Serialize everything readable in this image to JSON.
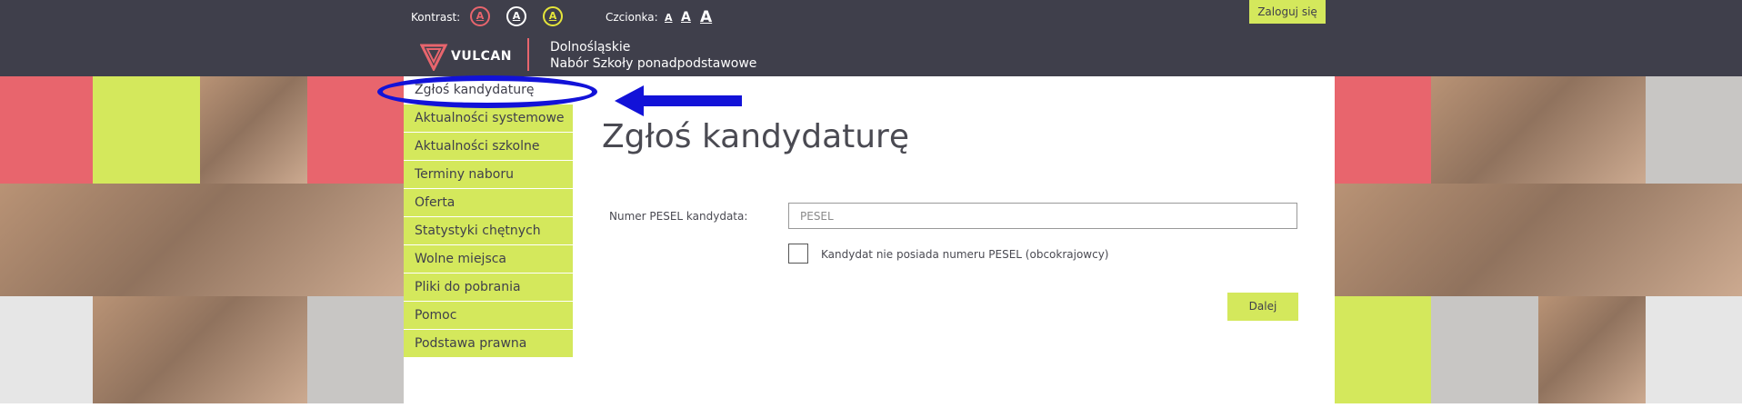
{
  "header": {
    "kontrast_label": "Kontrast:",
    "kontrast_options": [
      "A",
      "A",
      "A"
    ],
    "kontrast_colors": [
      "#e8656d",
      "#ffffff",
      "#e6e63a"
    ],
    "czcionka_label": "Czcionka:",
    "font_options": [
      "A",
      "A",
      "A"
    ],
    "login_label": "Zaloguj się",
    "logo_text": "VULCAN",
    "region": "Dolnośląskie",
    "subtitle": "Nabór Szkoły ponadpodstawowe"
  },
  "sidebar": {
    "items": [
      {
        "label": "Zgłoś kandydaturę",
        "active": true
      },
      {
        "label": "Aktualności systemowe",
        "active": false
      },
      {
        "label": "Aktualności szkolne",
        "active": false
      },
      {
        "label": "Terminy naboru",
        "active": false
      },
      {
        "label": "Oferta",
        "active": false
      },
      {
        "label": "Statystyki chętnych",
        "active": false
      },
      {
        "label": "Wolne miejsca",
        "active": false
      },
      {
        "label": "Pliki do pobrania",
        "active": false
      },
      {
        "label": "Pomoc",
        "active": false
      },
      {
        "label": "Podstawa prawna",
        "active": false
      }
    ]
  },
  "main": {
    "title": "Zgłoś kandydaturę",
    "pesel_label": "Numer PESEL kandydata:",
    "pesel_placeholder": "PESEL",
    "pesel_value": "",
    "no_pesel_label": "Kandydat nie posiada numeru PESEL (obcokrajowcy)",
    "no_pesel_checked": false,
    "next_button": "Dalej"
  },
  "colors": {
    "header_bg": "#3f3f4b",
    "accent_green": "#d4e85c",
    "accent_red": "#e8656d",
    "annotation_blue": "#1212d8"
  },
  "icons": [
    "vulcan-logo-icon",
    "annotation-ellipse",
    "annotation-arrow-icon"
  ]
}
